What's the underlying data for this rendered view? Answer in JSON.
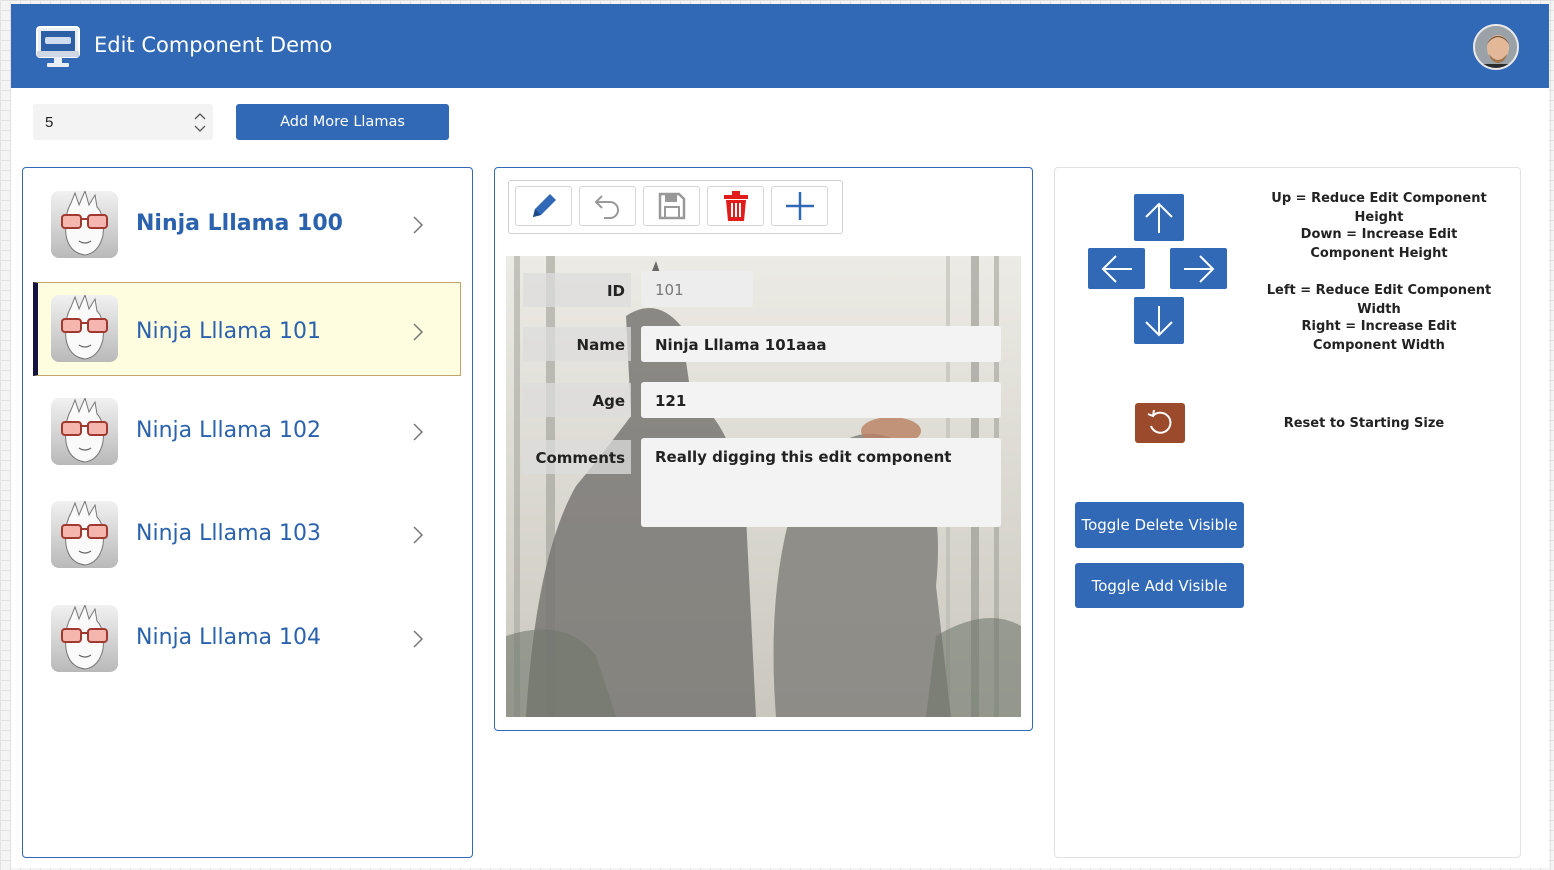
{
  "header": {
    "title": "Edit Component Demo",
    "logo_icon": "computer-monitor-icon",
    "avatar_icon": "user-avatar-icon"
  },
  "top_controls": {
    "stepper_value": "5",
    "add_more_label": "Add More Llamas"
  },
  "list": {
    "items": [
      {
        "label": "Ninja Lllama 100",
        "selected": false,
        "bold": true
      },
      {
        "label": "Ninja Lllama 101",
        "selected": true,
        "bold": false
      },
      {
        "label": "Ninja Lllama 102",
        "selected": false,
        "bold": false
      },
      {
        "label": "Ninja Lllama 103",
        "selected": false,
        "bold": false
      },
      {
        "label": "Ninja Lllama 104",
        "selected": false,
        "bold": false
      }
    ],
    "item_icon": "llama-sunglasses-icon",
    "chevron_icon": "chevron-right-icon"
  },
  "edit": {
    "toolbar": [
      "edit-pencil-icon",
      "undo-icon",
      "save-icon",
      "delete-trash-icon",
      "add-plus-icon"
    ],
    "fields": {
      "id_label": "ID",
      "id_value": "101",
      "name_label": "Name",
      "name_value": "Ninja Lllama 101aaa",
      "age_label": "Age",
      "age_value": "121",
      "comments_label": "Comments",
      "comments_value": "Really digging this edit component"
    }
  },
  "controls": {
    "help_up": "Up = Reduce Edit Component Height",
    "help_down": "Down = Increase Edit Component Height",
    "help_left": "Left = Reduce Edit Component Width",
    "help_right": "Right = Increase Edit Component Width",
    "help_reset": "Reset to Starting Size",
    "toggle_delete": "Toggle Delete Visible",
    "toggle_add": "Toggle Add Visible"
  },
  "colors": {
    "brand_blue": "#3169b6",
    "selected_bg": "#fffde0",
    "delete_red": "#e21b1b",
    "reset_brown": "#9b4a2c"
  }
}
